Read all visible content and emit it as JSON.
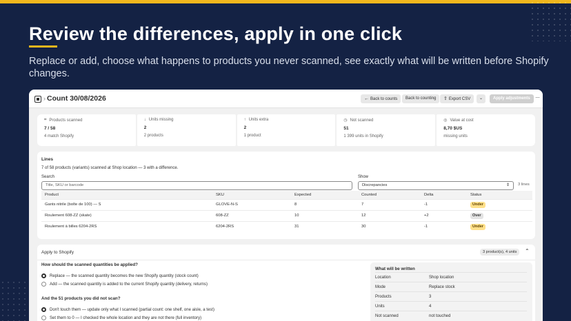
{
  "headline": "Review the differences, apply in one click",
  "subtitle": "Replace or add, choose what happens to products you never scanned, see exactly what will be written before Shopify changes.",
  "colors": {
    "accent": "#f2b71d",
    "background": "#142244",
    "under_badge": "#ffe08a",
    "over_badge": "#e3e3e3"
  },
  "window": {
    "title": "Count 30/08/2026",
    "icons": {
      "app": "list-icon",
      "breadcrumb": "chevron-right-icon",
      "back": "arrow-left-icon",
      "export": "export-icon",
      "dropdown": "chevron-down-icon",
      "more": "more-horizontal-icon"
    },
    "buttons": {
      "back_to_counts": "Back to counts",
      "back_to_counting": "Back to counting",
      "export_csv": "Export CSV",
      "dropdown": "⌄",
      "apply_adjustments": "Apply adjustments",
      "more": "···"
    }
  },
  "kpis": [
    {
      "icon": "barcode-icon",
      "glyph": "⌗",
      "label": "Products scanned",
      "value": "7 / 58",
      "sub": "4 match Shopify"
    },
    {
      "icon": "arrow-down-icon",
      "glyph": "↓",
      "label": "Units missing",
      "value": "2",
      "sub": "2 products"
    },
    {
      "icon": "arrow-up-icon",
      "glyph": "↑",
      "label": "Units extra",
      "value": "2",
      "sub": "1 product"
    },
    {
      "icon": "clock-icon",
      "glyph": "◷",
      "label": "Not scanned",
      "value": "51",
      "sub": "1 399 units in Shopify"
    },
    {
      "icon": "coin-icon",
      "glyph": "◎",
      "label": "Value at cost",
      "value": "8,70 $US",
      "sub": "missing units"
    }
  ],
  "lines": {
    "title": "Lines",
    "summary": "7 of 58 products (variants) scanned at Shop location — 3 with a difference.",
    "search_label": "Search",
    "search_placeholder": "Title, SKU or barcode",
    "show_label": "Show",
    "show_value": "Discrepancies",
    "count": "3 lines",
    "columns": [
      "Product",
      "SKU",
      "Expected",
      "Counted",
      "Delta",
      "Status"
    ],
    "rows": [
      {
        "product": "Gants nitrile (boîte de 100) — S",
        "sku": "GLOVE-N-S",
        "expected": "8",
        "counted": "7",
        "delta": "-1",
        "status": "Under"
      },
      {
        "product": "Roulement 608-ZZ (skate)",
        "sku": "608-ZZ",
        "expected": "10",
        "counted": "12",
        "delta": "+2",
        "status": "Over"
      },
      {
        "product": "Roulement à billes 6204-2RS",
        "sku": "6204-2RS",
        "expected": "31",
        "counted": "30",
        "delta": "-1",
        "status": "Under"
      }
    ]
  },
  "apply": {
    "title": "Apply to Shopify",
    "pill": "3 product(s), 4 units",
    "q1": "How should the scanned quantities be applied?",
    "q1_options": [
      {
        "label": "Replace — the scanned quantity becomes the new Shopify quantity (stock count)",
        "selected": true
      },
      {
        "label": "Add — the scanned quantity is added to the current Shopify quantity (delivery, returns)",
        "selected": false
      }
    ],
    "q2": "And the 51 products you did not scan?",
    "q2_options": [
      {
        "label": "Don't touch them — update only what I scanned (partial count: one shelf, one aisle, a test)",
        "selected": true
      },
      {
        "label": "Set them to 0 — I checked the whole location and they are not there (full inventory)",
        "selected": false
      }
    ],
    "written_title": "What will be written",
    "written": [
      {
        "key": "Location",
        "value": "Shop location"
      },
      {
        "key": "Mode",
        "value": "Replace stock"
      },
      {
        "key": "Products",
        "value": "3"
      },
      {
        "key": "Units",
        "value": "4"
      },
      {
        "key": "Not scanned",
        "value": "not touched"
      }
    ]
  }
}
